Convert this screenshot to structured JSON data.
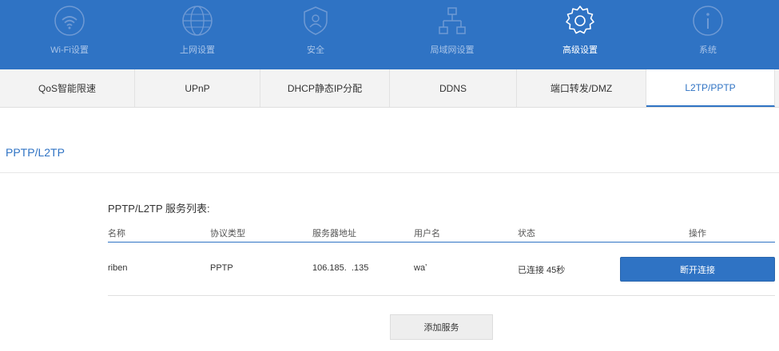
{
  "topnav": {
    "items": [
      {
        "label": "Wi-Fi设置",
        "icon": "wifi-icon"
      },
      {
        "label": "上网设置",
        "icon": "globe-icon"
      },
      {
        "label": "安全",
        "icon": "shield-user-icon"
      },
      {
        "label": "局域网设置",
        "icon": "network-icon"
      },
      {
        "label": "高级设置",
        "icon": "gear-icon",
        "active": true
      },
      {
        "label": "系统",
        "icon": "info-icon"
      }
    ]
  },
  "subnav": {
    "tabs": [
      {
        "label": "QoS智能限速"
      },
      {
        "label": "UPnP"
      },
      {
        "label": "DHCP静态IP分配"
      },
      {
        "label": "DDNS"
      },
      {
        "label": "端口转发/DMZ"
      },
      {
        "label": "L2TP/PPTP",
        "active": true
      }
    ]
  },
  "section": {
    "title": "PPTP/L2TP"
  },
  "service_list": {
    "title": "PPTP/L2TP 服务列表:",
    "columns": [
      "名称",
      "协议类型",
      "服务器地址",
      "用户名",
      "状态",
      "操作"
    ],
    "rows": [
      {
        "name": "riben",
        "protocol": "PPTP",
        "server": "106.185.  .135",
        "username": "waʼ",
        "status": "已连接 45秒",
        "action": "断开连接"
      }
    ]
  },
  "add_button": "添加服务",
  "colors": {
    "accent": "#2f73c4",
    "nav_inactive_text": "#a9c4e8"
  }
}
